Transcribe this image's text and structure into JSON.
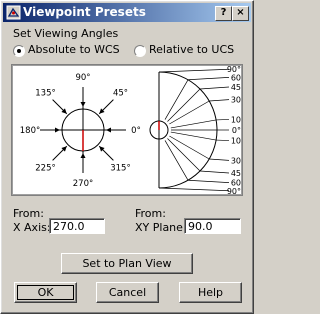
{
  "window": {
    "title": "Viewpoint Presets",
    "help_glyph": "?",
    "close_glyph": "×"
  },
  "viewing": {
    "group_label": "Set Viewing Angles",
    "absolute_label": "Absolute to WCS",
    "relative_label": "Relative to UCS",
    "selected": "absolute"
  },
  "compass": {
    "labels": [
      "90°",
      "45°",
      "0°",
      "315°",
      "270°",
      "225°",
      "180°",
      "135°"
    ]
  },
  "elevation": {
    "labels": [
      "90°",
      "60",
      "45",
      "30",
      "10",
      "0°",
      "10",
      "30",
      "45",
      "60",
      "90°"
    ]
  },
  "from_x": {
    "title": "From:",
    "label": "X Axis:",
    "value": "270.0"
  },
  "from_xy": {
    "title": "From:",
    "label": "XY Plane:",
    "value": "90.0"
  },
  "buttons": {
    "plan_view": "Set to Plan View",
    "ok": "OK",
    "cancel": "Cancel",
    "help": "Help"
  }
}
